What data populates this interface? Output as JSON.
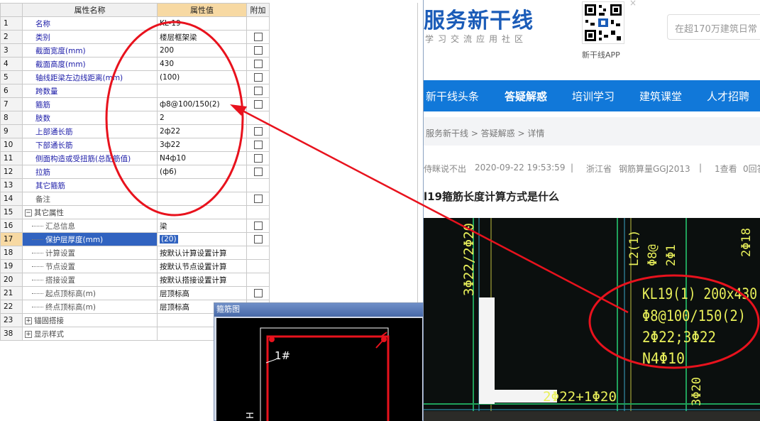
{
  "grid": {
    "headers": {
      "name": "属性名称",
      "value": "属性值",
      "extra": "附加"
    },
    "rows": [
      {
        "idx": "1",
        "name": "名称",
        "value": "KL-19"
      },
      {
        "idx": "2",
        "name": "类别",
        "value": "楼层框架梁"
      },
      {
        "idx": "3",
        "name": "截面宽度(mm)",
        "value": "200"
      },
      {
        "idx": "4",
        "name": "截面高度(mm)",
        "value": "430"
      },
      {
        "idx": "5",
        "name": "轴线距梁左边线距离(mm)",
        "value": "(100)"
      },
      {
        "idx": "6",
        "name": "跨数量",
        "value": ""
      },
      {
        "idx": "7",
        "name": "箍筋",
        "value": "ф8@100/150(2)"
      },
      {
        "idx": "8",
        "name": "肢数",
        "value": "2"
      },
      {
        "idx": "9",
        "name": "上部通长筋",
        "value": "2ф22"
      },
      {
        "idx": "10",
        "name": "下部通长筋",
        "value": "3ф22"
      },
      {
        "idx": "11",
        "name": "侧面构造或受扭筋(总配筋值)",
        "value": "N4ф10"
      },
      {
        "idx": "12",
        "name": "拉筋",
        "value": "(ф6)"
      },
      {
        "idx": "13",
        "name": "其它箍筋",
        "value": ""
      },
      {
        "idx": "14",
        "name": "备注",
        "value": ""
      },
      {
        "idx": "15",
        "name": "其它属性",
        "value": ""
      },
      {
        "idx": "16",
        "name": "汇总信息",
        "value": "梁"
      },
      {
        "idx": "17",
        "name": "保护层厚度(mm)",
        "value": "(20)"
      },
      {
        "idx": "18",
        "name": "计算设置",
        "value": "按默认计算设置计算"
      },
      {
        "idx": "19",
        "name": "节点设置",
        "value": "按默认节点设置计算"
      },
      {
        "idx": "20",
        "name": "搭接设置",
        "value": "按默认搭接设置计算"
      },
      {
        "idx": "21",
        "name": "起点顶标高(m)",
        "value": "层顶标高"
      },
      {
        "idx": "22",
        "name": "终点顶标高(m)",
        "value": "层顶标高"
      },
      {
        "idx": "23",
        "name": "锚固搭接",
        "value": ""
      },
      {
        "idx": "38",
        "name": "显示样式",
        "value": ""
      }
    ]
  },
  "rebar_window": {
    "title": "箍筋图",
    "bar_label": "1#",
    "dim_label": "H"
  },
  "web": {
    "brand": "服务新干线",
    "slogan": "学习交流应用社区",
    "qr_label": "新干线APP",
    "search_placeholder": "在超170万建筑日常",
    "nav": [
      "新干线头条",
      "答疑解惑",
      "培训学习",
      "建筑课堂",
      "人才招聘"
    ],
    "breadcrumb": "服务新干线 > 答疑解惑 > 详情",
    "meta": {
      "user": "侍眯说不出",
      "time": "2020-09-22 19:53:59",
      "sep": "|",
      "region": "浙江省",
      "software": "钢筋算量GGJ2013",
      "views": "1查看",
      "answers": "0回答"
    },
    "question_title": "l19箍筋长度计算方式是什么"
  },
  "photo_text": {
    "kl": "KL19(1) 200x430",
    "stirrup": "Φ8@100/150(2)",
    "bars": "2Φ22;3Φ22",
    "side": "N4Φ10",
    "bottom": "2Φ22+1Φ20",
    "left": "3Φ22/2Φ20",
    "right_top": "2Φ18",
    "right_bottom": "3Φ20",
    "col1": "L2(1)",
    "col2": "Φ8@",
    "col3": "2Φ1"
  },
  "colors": {
    "annotation": "#e8121d",
    "nav_bg": "#1178d9",
    "brand": "#1b5cb8",
    "cad_text": "#e9f05a",
    "selection": "#3163c0"
  }
}
